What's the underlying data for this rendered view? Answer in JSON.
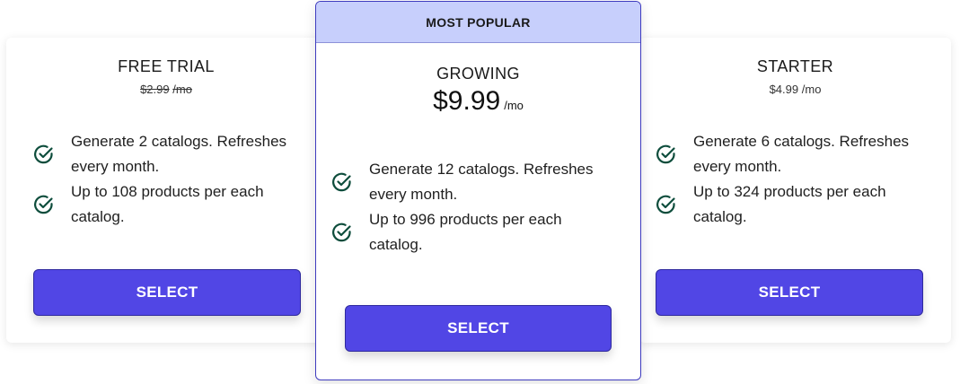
{
  "plans": [
    {
      "name": "FREE TRIAL",
      "price": "$2.99",
      "period": "/mo",
      "features": [
        "Generate 2 catalogs. Refreshes every month.",
        "Up to 108 products per each catalog."
      ],
      "button_label": "SELECT"
    },
    {
      "badge": "MOST POPULAR",
      "name": "GROWING",
      "price": "$9.99",
      "period": "/mo",
      "features": [
        "Generate 12 catalogs. Refreshes every month.",
        "Up to 996 products per each catalog."
      ],
      "button_label": "SELECT"
    },
    {
      "name": "STARTER",
      "price": "$4.99",
      "period": "/mo",
      "features": [
        "Generate 6 catalogs. Refreshes every month.",
        "Up to 324 products per each catalog."
      ],
      "button_label": "SELECT"
    }
  ],
  "icons": {
    "feature_check": "check-circle-icon"
  },
  "colors": {
    "accent": "#5146e5",
    "badge_bg": "#c7cffc",
    "check": "#0e4d3c"
  }
}
